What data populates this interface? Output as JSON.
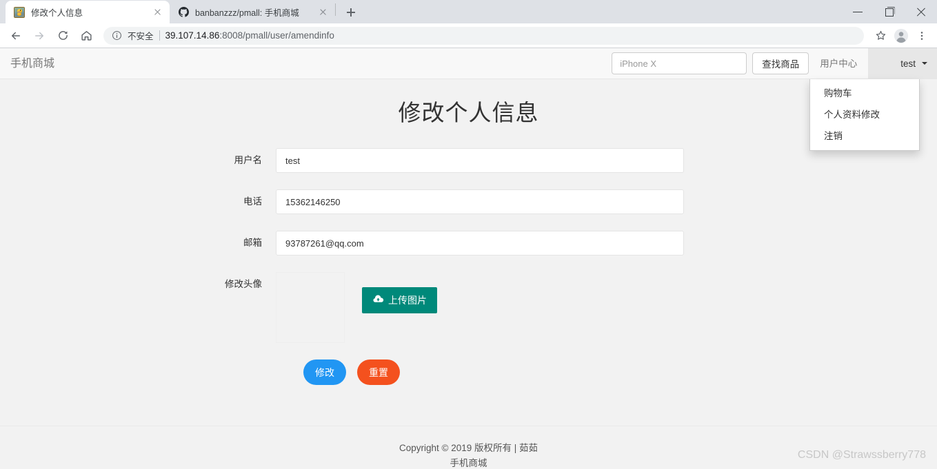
{
  "browser": {
    "tabs": [
      {
        "title": "修改个人信息",
        "favicon": "bee-avatar-icon",
        "active": true
      },
      {
        "title": "banbanzzz/pmall: 手机商城",
        "favicon": "github-icon",
        "active": false
      }
    ],
    "new_tab_label": "+",
    "window_controls": {
      "minimize": "minimize-icon",
      "maximize": "maximize-icon",
      "close": "close-icon"
    },
    "toolbar": {
      "back": "back-arrow-icon",
      "forward": "forward-arrow-icon",
      "reload": "reload-icon",
      "home": "home-icon",
      "security_label": "不安全",
      "url_host": "39.107.14.86",
      "url_rest": ":8008/pmall/user/amendinfo",
      "bookmark": "star-icon",
      "profile": "account-icon",
      "menu": "three-dot-menu-icon"
    }
  },
  "site": {
    "brand": "手机商城",
    "search": {
      "value": "",
      "placeholder": "iPhone X"
    },
    "search_button": "查找商品",
    "user_center_link": "用户中心",
    "user_name": "test",
    "avatar": "bee-avatar-icon",
    "dropdown_items": [
      "购物车",
      "个人资料修改",
      "注销"
    ]
  },
  "page": {
    "title": "修改个人信息",
    "fields": [
      {
        "label": "用户名",
        "value": "test",
        "name": "username"
      },
      {
        "label": "电话",
        "value": "15362146250",
        "name": "phone"
      },
      {
        "label": "邮箱",
        "value": "93787261@qq.com",
        "name": "email"
      }
    ],
    "avatar_label": "修改头像",
    "upload_button": "上传图片",
    "upload_icon": "cloud-upload-icon",
    "submit_button": "修改",
    "reset_button": "重置"
  },
  "footer": {
    "line1": "Copyright © 2019 版权所有 | 茹茹",
    "line2": "手机商城"
  },
  "watermark": "CSDN @Strawssberry778",
  "colors": {
    "upload_teal": "#00897a",
    "submit_blue": "#2196f3",
    "reset_orange": "#f4511e",
    "header_bg": "#f8f8f8",
    "page_bg": "#f2f2f2"
  }
}
